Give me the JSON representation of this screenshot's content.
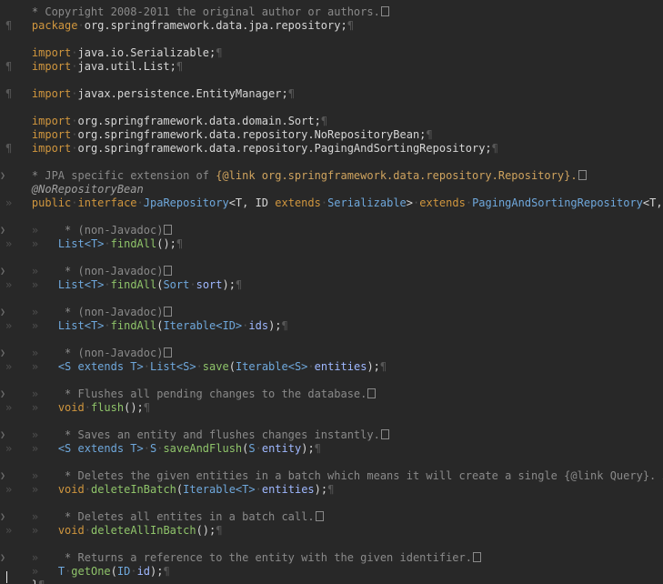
{
  "file": {
    "package_kw": "package",
    "package_name": "org.springframework.data.jpa.repository;",
    "import_kw": "import",
    "imports": [
      "java.io.Serializable;",
      "java.util.List;",
      "javax.persistence.EntityManager;",
      "org.springframework.data.domain.Sort;",
      "org.springframework.data.repository.NoRepositoryBean;",
      "org.springframework.data.repository.PagingAndSortingRepository;"
    ],
    "top_comment_partial": "* Copyright 2008-2011 the original author or authors.",
    "javadoc": {
      "prefix": "* JPA specific extension of ",
      "link": "{@link org.springframework.data.repository.Repository}."
    },
    "annotation": "@NoRepositoryBean",
    "declaration": {
      "public": "public",
      "interface": "interface",
      "name": "JpaRepository",
      "generic_open": "<T, ID ",
      "extends": "extends",
      "bound": "Serializable",
      "generic_close": ">",
      "super": "PagingAndSortingRepository",
      "super_generic": "<T, ID>",
      "brace": "{"
    },
    "methods": [
      {
        "comment": "* (non-Javadoc)",
        "ret": "List<T>",
        "name": "findAll",
        "params": "();"
      },
      {
        "comment": "* (non-Javadoc)",
        "ret": "List<T>",
        "name": "findAll",
        "ptype": "Sort",
        "pname": "sort"
      },
      {
        "comment": "* (non-Javadoc)",
        "ret": "List<T>",
        "name": "findAll",
        "ptype": "Iterable<ID>",
        "pname": "ids"
      },
      {
        "comment": "* (non-Javadoc)",
        "generic": "<S extends T>",
        "ret": "List<S>",
        "name": "save",
        "ptype": "Iterable<S>",
        "pname": "entities"
      },
      {
        "comment": "* Flushes all pending changes to the database.",
        "ret": "void",
        "name": "flush",
        "params": "();"
      },
      {
        "comment": "* Saves an entity and flushes changes instantly.",
        "generic": "<S extends T>",
        "ret": "S",
        "name": "saveAndFlush",
        "ptype": "S",
        "pname": "entity"
      },
      {
        "comment": "* Deletes the given entities in a batch which means it will create a single {@link Query}. Assume t",
        "ret": "void",
        "name": "deleteInBatch",
        "ptype": "Iterable<T>",
        "pname": "entities"
      },
      {
        "comment": "* Deletes all entites in a batch call.",
        "ret": "void",
        "name": "deleteAllInBatch",
        "params": "();"
      },
      {
        "comment": "* Returns a reference to the entity with the given identifier.",
        "ret": "T",
        "name": "getOne",
        "ptype": "ID",
        "pname": "id"
      }
    ],
    "closing_brace": "}",
    "pilcrow": "¶",
    "dot": "·",
    "tab": "»"
  }
}
